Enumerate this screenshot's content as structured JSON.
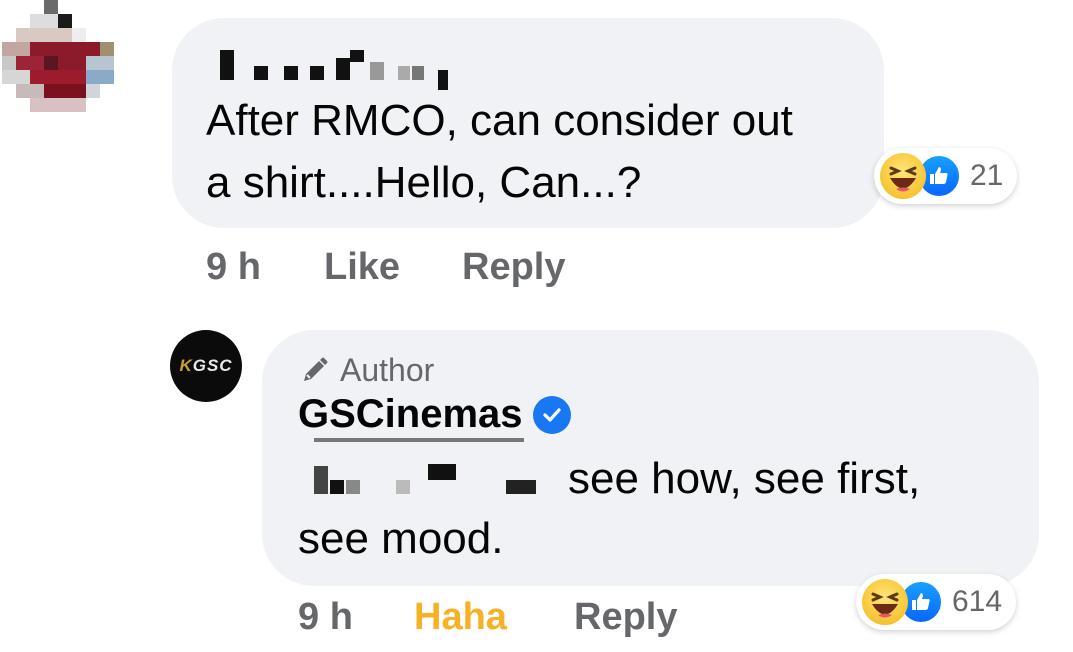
{
  "comment1": {
    "text_line1": "After RMCO, can consider out",
    "text_line2": "a shirt....Hello, Can...?",
    "reaction_count": "21",
    "time": "9 h",
    "like_label": "Like",
    "reply_label": "Reply"
  },
  "comment2": {
    "badge_label": "Author",
    "author_name": "GSCinemas",
    "logo_text": "GSC",
    "text_line1": "see how, see first,",
    "text_line2": "see mood.",
    "reaction_count": "614",
    "time": "9 h",
    "reaction_label": "Haha",
    "reply_label": "Reply"
  },
  "icons": [
    "haha-reaction-icon",
    "like-reaction-icon",
    "pencil-icon",
    "verified-badge-icon"
  ],
  "colors": {
    "bubble": "#f0f2f5",
    "meta_text": "#65676b",
    "haha_active": "#f7b125",
    "like_blue": "#1877f2"
  }
}
